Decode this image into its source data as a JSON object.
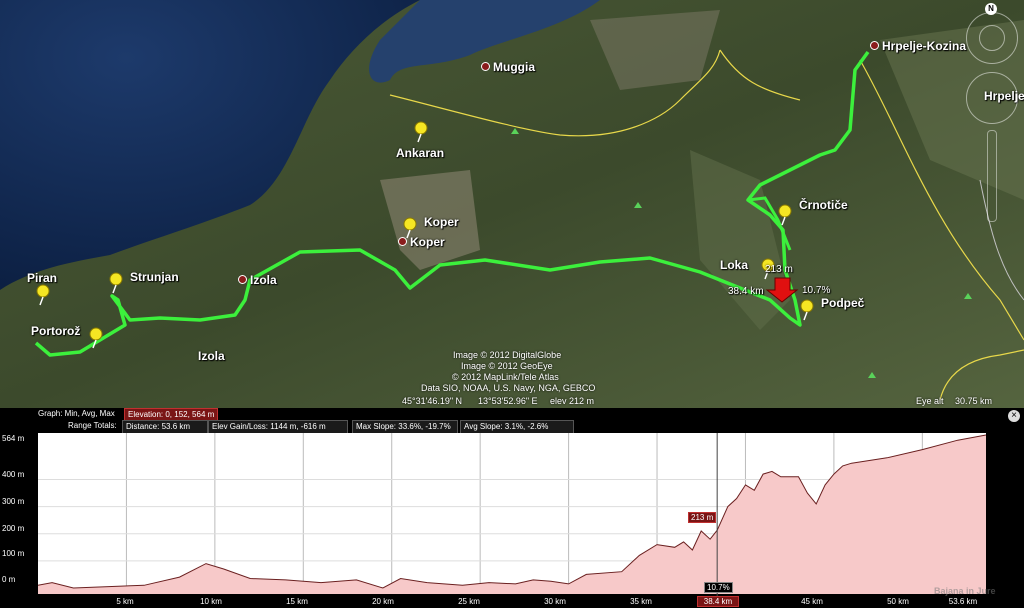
{
  "map": {
    "places": [
      {
        "key": "muggia",
        "label": "Muggia",
        "dot": true
      },
      {
        "key": "ankaran",
        "label": "Ankaran",
        "dot": false
      },
      {
        "key": "koper_pin",
        "label": "Koper",
        "dot": false
      },
      {
        "key": "koper",
        "label": "Koper",
        "dot": true
      },
      {
        "key": "izola",
        "label": "Izola",
        "dot": true
      },
      {
        "key": "izola2",
        "label": "Izola",
        "dot": false
      },
      {
        "key": "strunjan",
        "label": "Strunjan",
        "dot": false
      },
      {
        "key": "piran",
        "label": "Piran",
        "dot": false
      },
      {
        "key": "portoroz",
        "label": "Portorož",
        "dot": false
      },
      {
        "key": "loka",
        "label": "Loka",
        "dot": false
      },
      {
        "key": "crnotice",
        "label": "Črnotiče",
        "dot": false
      },
      {
        "key": "podpec",
        "label": "Podpeč",
        "dot": false
      },
      {
        "key": "hrpelje",
        "label": "Hrpelje-Kozina",
        "dot": true
      },
      {
        "key": "hrpelje2",
        "label": "Hrpelje",
        "dot": false
      }
    ],
    "cursor": {
      "elevation": "213 m",
      "distance": "38.4 km",
      "slope": "10.7%"
    },
    "credits": [
      "Image © 2012 DigitalGlobe",
      "Image © 2012 GeoEye",
      "© 2012 MapLink/Tele Atlas",
      "Data SIO, NOAA, U.S. Navy, NGA, GEBCO"
    ],
    "coords": {
      "lat": "45°31'46.19\" N",
      "lon": "13°53'52.96\" E",
      "elev": "elev  212 m"
    },
    "eye_alt": {
      "label": "Eye alt",
      "value": "30.75 km"
    },
    "compass_label": "N"
  },
  "profile": {
    "graph_label": "Graph: Min, Avg, Max",
    "graph_value": "Elevation: 0, 152, 564 m",
    "range_label": "Range Totals:",
    "distance": "Distance: 53.6 km",
    "elev_gain": "Elev Gain/Loss: 1144 m, -616 m",
    "max_slope": "Max Slope: 33.6%, -19.7%",
    "avg_slope": "Avg Slope: 3.1%, -2.6%",
    "y_ticks": [
      "564 m",
      "400 m",
      "300 m",
      "200 m",
      "100 m",
      "0 m"
    ],
    "x_ticks": [
      "5 km",
      "10 km",
      "15 km",
      "20 km",
      "25 km",
      "30 km",
      "35 km",
      "38.4 km",
      "45 km",
      "50 km",
      "53.6 km"
    ],
    "cursor_elev": "213 m",
    "cursor_slope": "10.7%",
    "watermark": "Bajana in Jure"
  },
  "chart_data": {
    "type": "area",
    "title": "",
    "xlabel": "",
    "ylabel": "",
    "xlim": [
      0,
      53.6
    ],
    "ylim": [
      0,
      564
    ],
    "x": [
      0,
      0.8,
      2,
      4,
      6,
      8,
      9.5,
      10.5,
      12,
      14,
      16,
      18,
      19.5,
      20.5,
      22,
      24,
      25.5,
      27,
      28,
      29,
      30,
      31,
      33,
      34,
      35,
      36,
      36.5,
      37,
      37.5,
      38,
      38.4,
      39,
      39.5,
      40,
      40.5,
      41,
      41.5,
      42,
      43,
      43.5,
      44,
      44.5,
      45,
      45.5,
      46,
      47,
      48,
      50,
      52,
      53.6
    ],
    "y": [
      10,
      20,
      0,
      5,
      10,
      40,
      90,
      70,
      35,
      30,
      20,
      30,
      0,
      35,
      20,
      10,
      20,
      15,
      30,
      25,
      15,
      50,
      60,
      120,
      160,
      150,
      170,
      140,
      210,
      180,
      213,
      300,
      330,
      380,
      360,
      420,
      430,
      410,
      410,
      350,
      310,
      380,
      420,
      450,
      460,
      470,
      480,
      510,
      545,
      564
    ],
    "cursor": {
      "x": 38.4,
      "y": 213,
      "slope": "10.7%"
    }
  }
}
